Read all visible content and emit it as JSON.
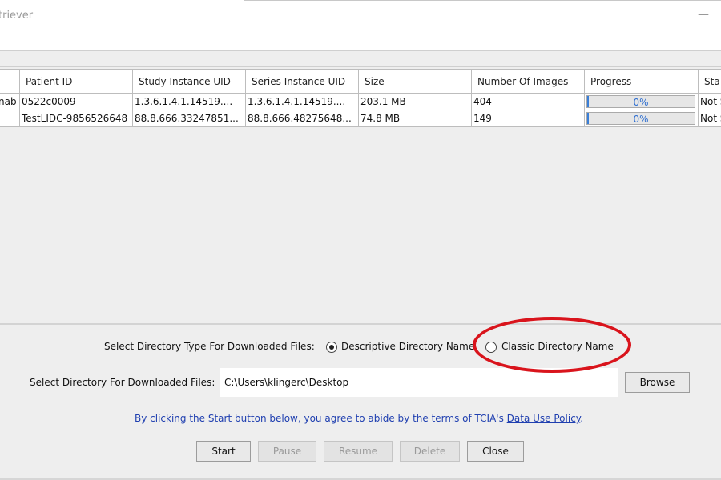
{
  "window": {
    "title": "triever",
    "minimize_glyph": "—"
  },
  "table": {
    "columns": [
      {
        "key": "c0",
        "label": ""
      },
      {
        "key": "patient",
        "label": "Patient ID"
      },
      {
        "key": "study",
        "label": "Study Instance UID"
      },
      {
        "key": "series",
        "label": "Series Instance UID"
      },
      {
        "key": "size",
        "label": "Size"
      },
      {
        "key": "num",
        "label": "Number Of Images"
      },
      {
        "key": "progress",
        "label": "Progress"
      },
      {
        "key": "status",
        "label": "Sta"
      }
    ],
    "rows": [
      {
        "c0": "nab",
        "patient": "0522c0009",
        "study": "1.3.6.1.4.1.14519....",
        "series": "1.3.6.1.4.1.14519....",
        "size": "203.1 MB",
        "num": "404",
        "progress": "0%",
        "progress_value": 0,
        "status": "Not S"
      },
      {
        "c0": "",
        "patient": "TestLIDC-9856526648",
        "study": "88.8.666.33247851...",
        "series": "88.8.666.48275648...",
        "size": "74.8 MB",
        "num": "149",
        "progress": "0%",
        "progress_value": 0,
        "status": "Not S"
      }
    ]
  },
  "directory_type": {
    "label": "Select Directory Type For Downloaded Files:",
    "options": [
      {
        "label": "Descriptive Directory Name",
        "selected": true
      },
      {
        "label": "Classic Directory Name",
        "selected": false
      }
    ]
  },
  "directory": {
    "label": "Select Directory For Downloaded Files:",
    "value": "C:\\Users\\klingerc\\Desktop",
    "browse_label": "Browse"
  },
  "notice": {
    "text": "By clicking the Start button below, you agree to abide by the terms of TCIA's",
    "link": "Data Use Policy",
    "end": "."
  },
  "buttons": {
    "start": {
      "label": "Start",
      "enabled": true
    },
    "pause": {
      "label": "Pause",
      "enabled": false
    },
    "resume": {
      "label": "Resume",
      "enabled": false
    },
    "delete": {
      "label": "Delete",
      "enabled": false
    },
    "close": {
      "label": "Close",
      "enabled": true
    }
  },
  "colors": {
    "annotation": "#d9141c",
    "progress": "#3a7fd8",
    "notice": "#1f3fb0"
  }
}
